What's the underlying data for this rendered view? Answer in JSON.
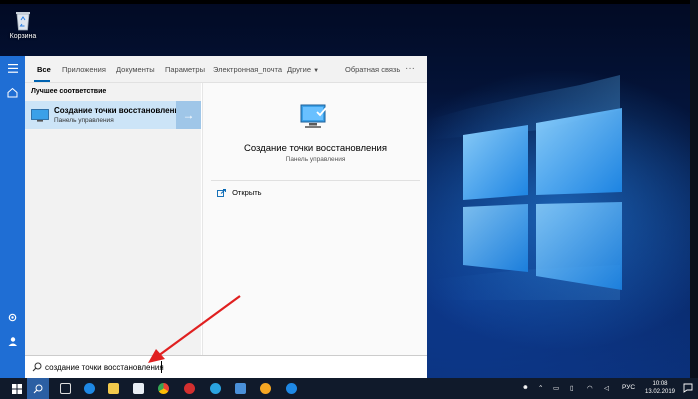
{
  "desktop": {
    "recycle_bin_label": "Корзина"
  },
  "start_menu": {
    "rail_icons": [
      "hamburger-icon",
      "home-icon",
      "settings-icon",
      "user-icon"
    ],
    "tabs": [
      {
        "label": "Все",
        "active": true
      },
      {
        "label": "Приложения"
      },
      {
        "label": "Документы"
      },
      {
        "label": "Параметры"
      },
      {
        "label": "Электронная_почта"
      },
      {
        "label": "Другие"
      }
    ],
    "feedback_label": "Обратная связь",
    "more_label": "···",
    "best_match_heading": "Лучшее соответствие",
    "best_match": {
      "title": "Создание точки восстановления",
      "subtitle": "Панель управления",
      "arrow": "→"
    },
    "detail": {
      "title": "Создание точки восстановления",
      "subtitle": "Панель управления",
      "open_label": "Открыть"
    },
    "search_query": "создание точки восстановления"
  },
  "taskbar": {
    "language": "РУС",
    "time": "10:08",
    "date": "13.02.2019",
    "apps": [
      "task-view",
      "edge",
      "file-explorer",
      "store",
      "chrome",
      "opera",
      "telegram",
      "mail",
      "yandex",
      "messenger"
    ]
  },
  "colors": {
    "accent": "#0063b1",
    "rail": "#1f6ed4",
    "selection": "#cce4f7",
    "annotation_arrow": "#e02020"
  }
}
